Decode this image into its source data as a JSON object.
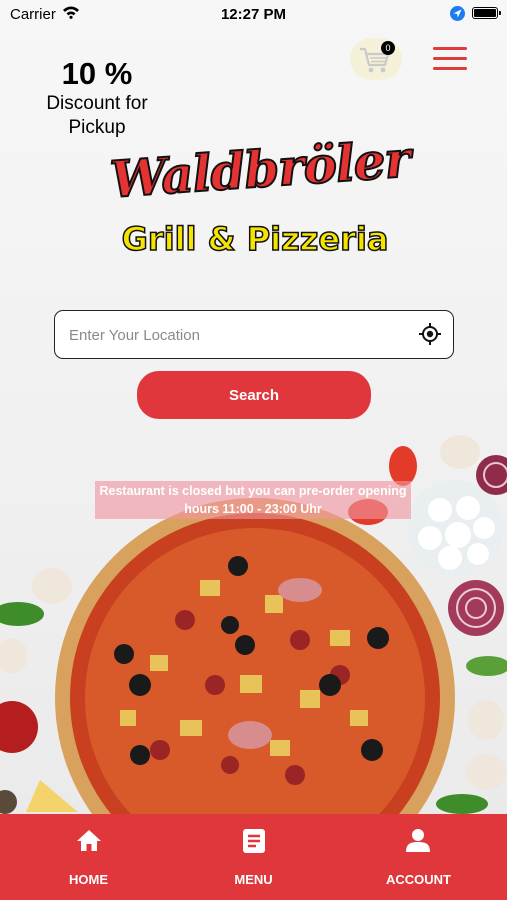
{
  "status_bar": {
    "carrier": "Carrier",
    "time": "12:27 PM"
  },
  "promo": {
    "percent": "10 %",
    "label_line1": "Discount for",
    "label_line2": "Pickup"
  },
  "cart": {
    "count": "0",
    "icon": "cart-icon"
  },
  "menu": {
    "icon": "hamburger-menu-icon"
  },
  "logo": {
    "line1": "Waldbröler",
    "line2": "Grill & Pizzeria"
  },
  "location": {
    "placeholder": "Enter Your Location",
    "icon": "gps-target-icon"
  },
  "search": {
    "label": "Search"
  },
  "notice": {
    "text": "Restaurant is closed but you can pre-order opening hours 11:00 - 23:00 Uhr"
  },
  "nav": {
    "items": [
      {
        "label": "HOME",
        "icon": "home-icon"
      },
      {
        "label": "MENU",
        "icon": "menu-book-icon"
      },
      {
        "label": "ACCOUNT",
        "icon": "user-icon"
      }
    ]
  },
  "colors": {
    "brand_red": "#e0373c",
    "logo_yellow": "#f5e400"
  }
}
